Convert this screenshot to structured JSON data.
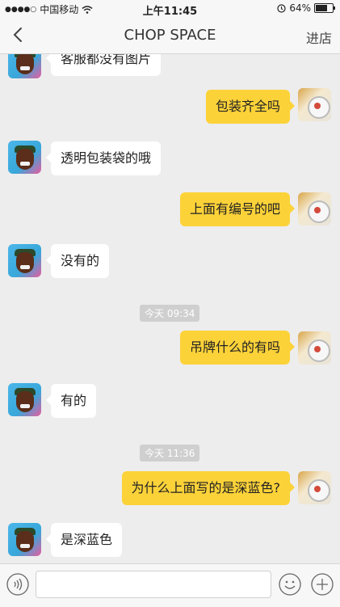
{
  "status_bar": {
    "carrier": "中国移动",
    "time": "上午11:45",
    "battery": "64%"
  },
  "nav": {
    "title": "CHOP SPACE",
    "right_link": "进店"
  },
  "messages": [
    {
      "side": "left",
      "text": "客服都没有图片"
    },
    {
      "side": "right",
      "text": "包装齐全吗"
    },
    {
      "side": "left",
      "text": "透明包装袋的哦"
    },
    {
      "side": "right",
      "text": "上面有编号的吧"
    },
    {
      "side": "left",
      "text": "没有的"
    },
    {
      "side": "time",
      "text": "今天 09:34"
    },
    {
      "side": "right",
      "text": "吊牌什么的有吗"
    },
    {
      "side": "left",
      "text": "有的"
    },
    {
      "side": "time",
      "text": "今天 11:36"
    },
    {
      "side": "right",
      "text": "为什么上面写的是深蓝色?"
    },
    {
      "side": "left",
      "text": "是深蓝色"
    }
  ],
  "icons": {
    "back": "chevron-left-icon",
    "voice": "voice-icon",
    "emoji": "emoji-icon",
    "plus": "plus-icon",
    "wifi": "wifi-icon",
    "alarm": "alarm-icon"
  },
  "colors": {
    "bubble_right": "#fcd239",
    "bubble_left": "#ffffff",
    "background": "#ededed"
  }
}
